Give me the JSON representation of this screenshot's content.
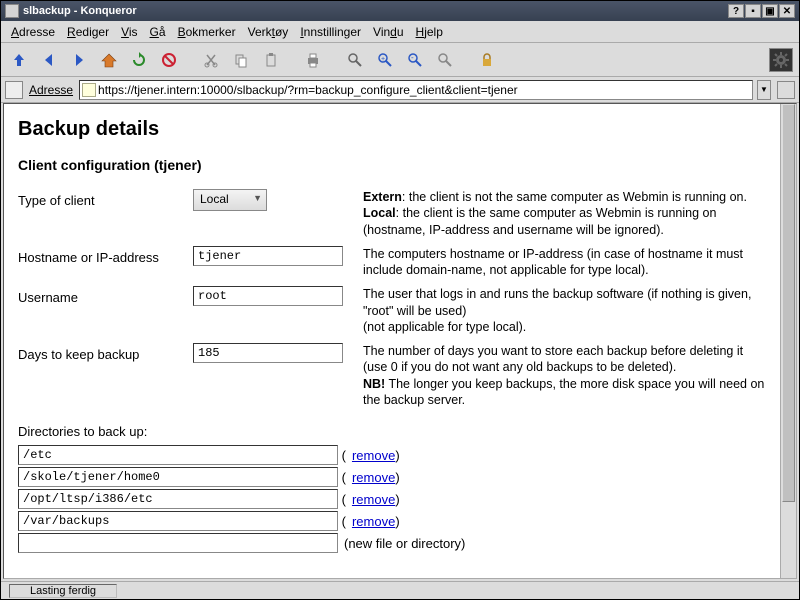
{
  "window": {
    "title": "slbackup - Konqueror"
  },
  "menus": [
    "Adresse",
    "Rediger",
    "Vis",
    "Gå",
    "Bokmerker",
    "Verktøy",
    "Innstillinger",
    "Vindu",
    "Hjelp"
  ],
  "addressbar": {
    "label": "Adresse",
    "url": "https://tjener.intern:10000/slbackup/?rm=backup_configure_client&client=tjener"
  },
  "page": {
    "heading": "Backup details",
    "subtitle": "Client configuration (tjener)",
    "fields": {
      "type": {
        "label": "Type of client",
        "value": "Local",
        "desc_extern_b": "Extern",
        "desc_extern": ": the client is not the same computer as Webmin is running on.",
        "desc_local_b": "Local",
        "desc_local": ": the client is the same computer as Webmin is running on (hostname, IP-address and username will be ignored)."
      },
      "host": {
        "label": "Hostname or IP-address",
        "value": "tjener",
        "desc": "The computers hostname or IP-address (in case of hostname it must include domain-name, not applicable for type local)."
      },
      "user": {
        "label": "Username",
        "value": "root",
        "desc": "The user that logs in and runs the backup software (if nothing is given, \"root\" will be used)",
        "desc2": "(not applicable for type local)."
      },
      "days": {
        "label": "Days to keep backup",
        "value": "185",
        "desc1": "The number of days you want to store each backup before deleting it (use 0 if you do not want any old backups to be deleted).",
        "desc2_b": "NB!",
        "desc2": " The longer you keep backups, the more disk space you will need on the backup server."
      }
    },
    "dirs_label": "Directories to back up:",
    "dirs": [
      "/etc",
      "/skole/tjener/home0",
      "/opt/ltsp/i386/etc",
      "/var/backups"
    ],
    "remove": "remove",
    "newdir": "(new file or directory)"
  },
  "status": "Lasting ferdig"
}
